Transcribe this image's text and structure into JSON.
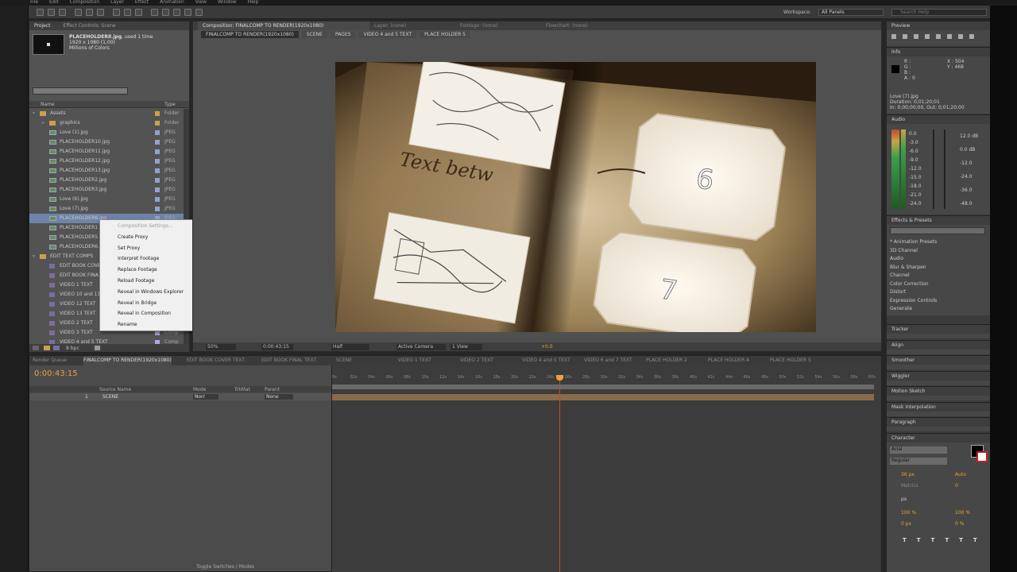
{
  "menu": [
    "File",
    "Edit",
    "Composition",
    "Layer",
    "Effect",
    "Animation",
    "View",
    "Window",
    "Help"
  ],
  "toolbar": {
    "workspace_label": "Workspace:",
    "workspace_value": "All Panels",
    "search_placeholder": "Search Help"
  },
  "project": {
    "tabs": [
      "Project",
      "Effect Controls: Scene"
    ],
    "file_name": "PLACEHOLDER8.jpg",
    "file_used": ", used 1 time",
    "file_dims": "1920 x 1080 (1,00)",
    "file_colors": "Millions of Colors",
    "search_placeholder": "",
    "col_name": "Name",
    "col_type": "Type",
    "items": [
      {
        "indent": 0,
        "kind": "folder",
        "name": "Assets",
        "type": "Folder",
        "label": "#c9a14a",
        "open": true
      },
      {
        "indent": 1,
        "kind": "folder",
        "name": "graphics",
        "type": "Folder",
        "label": "#c9a14a",
        "open": false
      },
      {
        "indent": 1,
        "kind": "file",
        "name": "Love (1).jpg",
        "type": "JPEG",
        "label": "#8fa4c9"
      },
      {
        "indent": 1,
        "kind": "file",
        "name": "PLACEHOLDER10.jpg",
        "type": "JPEG",
        "label": "#8fa4c9"
      },
      {
        "indent": 1,
        "kind": "file",
        "name": "PLACEHOLDER11.jpg",
        "type": "JPEG",
        "label": "#8fa4c9"
      },
      {
        "indent": 1,
        "kind": "file",
        "name": "PLACEHOLDER12.jpg",
        "type": "JPEG",
        "label": "#8fa4c9"
      },
      {
        "indent": 1,
        "kind": "file",
        "name": "PLACEHOLDER13.jpg",
        "type": "JPEG",
        "label": "#8fa4c9"
      },
      {
        "indent": 1,
        "kind": "file",
        "name": "PLACEHOLDER2.jpg",
        "type": "JPEG",
        "label": "#8fa4c9"
      },
      {
        "indent": 1,
        "kind": "file",
        "name": "PLACEHOLDER3.jpg",
        "type": "JPEG",
        "label": "#8fa4c9"
      },
      {
        "indent": 1,
        "kind": "file",
        "name": "Love (6).jpg",
        "type": "JPEG",
        "label": "#8fa4c9"
      },
      {
        "indent": 1,
        "kind": "file",
        "name": "Love (7).jpg",
        "type": "JPEG",
        "label": "#8fa4c9"
      },
      {
        "indent": 1,
        "kind": "file",
        "name": "PLACEHOLDER8.jpg",
        "type": "JPEG",
        "label": "#8fa4c9",
        "selected": true
      },
      {
        "indent": 1,
        "kind": "file",
        "name": "PLACEHOLDER1",
        "type": "JPEG",
        "label": "#8fa4c9"
      },
      {
        "indent": 1,
        "kind": "file",
        "name": "PLACEHOLDER5",
        "type": "JPEG",
        "label": "#8fa4c9"
      },
      {
        "indent": 1,
        "kind": "file",
        "name": "PLACEHOLDER6.jpg",
        "type": "JPEG",
        "label": "#8fa4c9"
      },
      {
        "indent": 0,
        "kind": "folder",
        "name": "EDIT TEXT COMPS",
        "type": "Folder",
        "label": "#c9a14a",
        "open": true
      },
      {
        "indent": 1,
        "kind": "comp",
        "name": "EDIT BOOK COVE",
        "type": "Comp",
        "label": "#b9a3d9"
      },
      {
        "indent": 1,
        "kind": "comp",
        "name": "EDIT BOOK FINA",
        "type": "Comp",
        "label": "#b9a3d9"
      },
      {
        "indent": 1,
        "kind": "comp",
        "name": "VIDEO 1 TEXT",
        "type": "Comp",
        "label": "#b9a3d9"
      },
      {
        "indent": 1,
        "kind": "comp",
        "name": "VIDEO 10 and 11",
        "type": "Comp",
        "label": "#b9a3d9"
      },
      {
        "indent": 1,
        "kind": "comp",
        "name": "VIDEO 12 TEXT",
        "type": "Comp",
        "label": "#b9a3d9"
      },
      {
        "indent": 1,
        "kind": "comp",
        "name": "VIDEO 13 TEXT",
        "type": "Comp",
        "label": "#b9a3d9"
      },
      {
        "indent": 1,
        "kind": "comp",
        "name": "VIDEO 2 TEXT",
        "type": "Comp",
        "label": "#b9a3d9"
      },
      {
        "indent": 1,
        "kind": "comp",
        "name": "VIDEO 3 TEXT",
        "type": "Comp",
        "label": "#b9a3d9"
      },
      {
        "indent": 1,
        "kind": "comp",
        "name": "VIDEO 4 and 5 TEXT",
        "type": "Comp",
        "label": "#b9a3d9"
      }
    ],
    "bpc": "8 bpc"
  },
  "context_menu": {
    "items": [
      {
        "label": "Composition Settings...",
        "disabled": true,
        "submenu": false
      },
      {
        "label": "Create Proxy",
        "disabled": false,
        "submenu": true
      },
      {
        "label": "Set Proxy",
        "disabled": false,
        "submenu": true
      },
      {
        "label": "Interpret Footage",
        "disabled": false,
        "submenu": true
      },
      {
        "label": "Replace Footage",
        "disabled": false,
        "submenu": true
      },
      {
        "label": "Reload Footage",
        "disabled": false,
        "submenu": false
      },
      {
        "label": "Reveal in Windows Explorer",
        "disabled": false,
        "submenu": false
      },
      {
        "label": "Reveal in Bridge",
        "disabled": false,
        "submenu": false
      },
      {
        "label": "Reveal in Composition",
        "disabled": false,
        "submenu": true
      },
      {
        "label": "Rename",
        "disabled": false,
        "submenu": false
      }
    ]
  },
  "viewer": {
    "tabs": [
      "Composition: FINALCOMP TO RENDER(1920x1080)",
      "Layer: (none)",
      "Footage: (none)",
      "Flowchart: (none)"
    ],
    "breadcrumbs": [
      "FINALCOMP TO RENDER(1920x1080)",
      "SCENE",
      "PAGES",
      "VIDEO 4 and 5 TEXT",
      "PLACE HOLDER 5"
    ],
    "frame_text": "Text betw",
    "frame_num_top": "6",
    "frame_num_bottom": "7",
    "zoom": "50%",
    "timecode": "0:00:43:15",
    "resolution": "Half",
    "camera": "Active Camera",
    "views": "1 View",
    "exposure": "+0.0"
  },
  "timeline": {
    "tabs": [
      "Render Queue",
      "FINALCOMP TO RENDER(1920x1080)",
      "EDIT BOOK COVER TEXT",
      "EDIT BOOK FINAL TEXT",
      "SCENE",
      "VIDEO 1 TEXT",
      "VIDEO 2 TEXT",
      "VIDEO 4 and 5 TEXT",
      "VIDEO 6 and 7 TEXT",
      "PLACE HOLDER 2",
      "PLACE HOLDER 4",
      "PLACE HOLDER 5"
    ],
    "timecode": "0:00:43:15",
    "col_source": "Source Name",
    "col_mode": "Mode",
    "col_trkmat": "TrkMat",
    "col_parent": "Parent",
    "layer_num": "1",
    "layer_name": "SCENE",
    "layer_mode": "Norr",
    "layer_parent": "None",
    "ruler": [
      "0s",
      "02s",
      "04s",
      "06s",
      "08s",
      "10s",
      "12s",
      "14s",
      "16s",
      "18s",
      "20s",
      "22s",
      "24s",
      "26s",
      "28s",
      "30s",
      "32s",
      "34s",
      "36s",
      "38s",
      "40s",
      "42s",
      "44s",
      "46s",
      "48s",
      "50s",
      "52s",
      "54s",
      "56s",
      "58s",
      "60s"
    ],
    "toggle_label": "Toggle Switches / Modes"
  },
  "right": {
    "preview_title": "Preview",
    "info_title": "Info",
    "info_r": "R :",
    "info_g": "G :",
    "info_b": "B :",
    "info_a": "A : 0",
    "info_x": "X : 504",
    "info_y": "Y : 468",
    "info_file": "Love (7).jpg",
    "info_duration": "Duration: 0;01;20;01",
    "info_in": "In: 0;00;00;00, Out: 0;01;20;00",
    "audio_title": "Audio",
    "audio_db_left": [
      "0.0",
      "-3.0",
      "-6.0",
      "-9.0",
      "-12.0",
      "-15.0",
      "-18.0",
      "-21.0",
      "-24.0"
    ],
    "audio_db_right": [
      "12.0 dB",
      "0.0 dB",
      "-12.0",
      "-24.0",
      "-36.0",
      "-48.0"
    ],
    "effects_title": "Effects & Presets",
    "effects_items": [
      "* Animation Presets",
      "3D Channel",
      "Audio",
      "Blur & Sharpen",
      "Channel",
      "Color Correction",
      "Distort",
      "Expression Controls",
      "Generate"
    ],
    "panels": [
      "Tracker",
      "Align",
      "Smoother",
      "Wiggler",
      "Motion Sketch",
      "Mask Interpolation",
      "Paragraph",
      "Character"
    ],
    "character": {
      "font": "Arial",
      "style": "Regular",
      "size": "36 px",
      "leading": "Auto",
      "kerning": "Metrics",
      "tracking": "0",
      "px": "px",
      "vscale": "100 %",
      "hscale": "100 %",
      "baseline": "0 px",
      "tsume": "0 %"
    }
  },
  "colors": {
    "accent": "#e8a23a",
    "selected": "#6e84a8",
    "playhead": "#c04a2a"
  }
}
